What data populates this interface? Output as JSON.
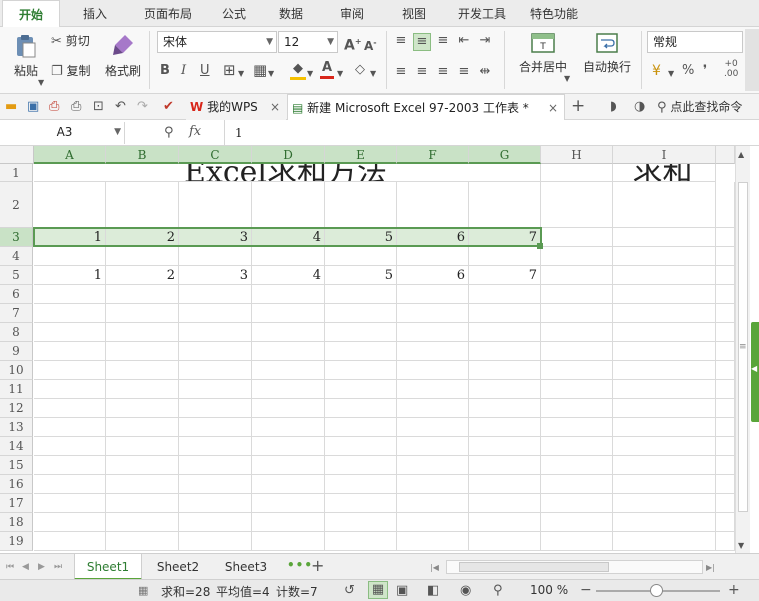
{
  "menu_tabs": [
    "开始",
    "插入",
    "页面布局",
    "公式",
    "数据",
    "审阅",
    "视图",
    "开发工具",
    "特色功能"
  ],
  "active_tab_index": 0,
  "ribbon": {
    "paste_label": "粘贴",
    "cut_label": "剪切",
    "copy_label": "复制",
    "format_painter_label": "格式刷",
    "font_name": "宋体",
    "font_size": "12",
    "bold": "B",
    "italic": "I",
    "underline": "U",
    "font_color_letter": "A",
    "merge_center_label": "合并居中",
    "wrap_text_label": "自动换行",
    "number_format": "常规",
    "percent": "%",
    "comma": "❜"
  },
  "quick_bar": {
    "wps_tab": "我的WPS",
    "doc_tab": "新建 Microsoft Excel 97-2003 工作表 *",
    "find_command": "点此查找命令"
  },
  "formula_bar": {
    "name_box": "A3",
    "fx": "fx",
    "value": "1"
  },
  "columns": [
    "A",
    "B",
    "C",
    "D",
    "E",
    "F",
    "G",
    "H",
    "I"
  ],
  "selected_columns": [
    "A",
    "B",
    "C",
    "D",
    "E",
    "F",
    "G"
  ],
  "rows": [
    "1",
    "2",
    "3",
    "4",
    "5",
    "6",
    "7",
    "8",
    "9",
    "10",
    "11",
    "12",
    "13",
    "14",
    "15",
    "16",
    "17",
    "18",
    "19"
  ],
  "selected_row": "3",
  "cells": {
    "title": "Excel求和方法",
    "sum_header": "求和",
    "row3": [
      "1",
      "2",
      "3",
      "4",
      "5",
      "6",
      "7"
    ],
    "row5": [
      "1",
      "2",
      "3",
      "4",
      "5",
      "6",
      "7"
    ]
  },
  "sheets": [
    "Sheet1",
    "Sheet2",
    "Sheet3"
  ],
  "active_sheet_index": 0,
  "status": {
    "sum": "求和=28",
    "average": "平均值=4",
    "count": "计数=7",
    "zoom": "100 %",
    "zoom_level_percent": 100
  },
  "colors": {
    "accent_green": "#2e7d32",
    "selection_fill": "#dcecd9",
    "selection_border": "#5a9a53"
  }
}
